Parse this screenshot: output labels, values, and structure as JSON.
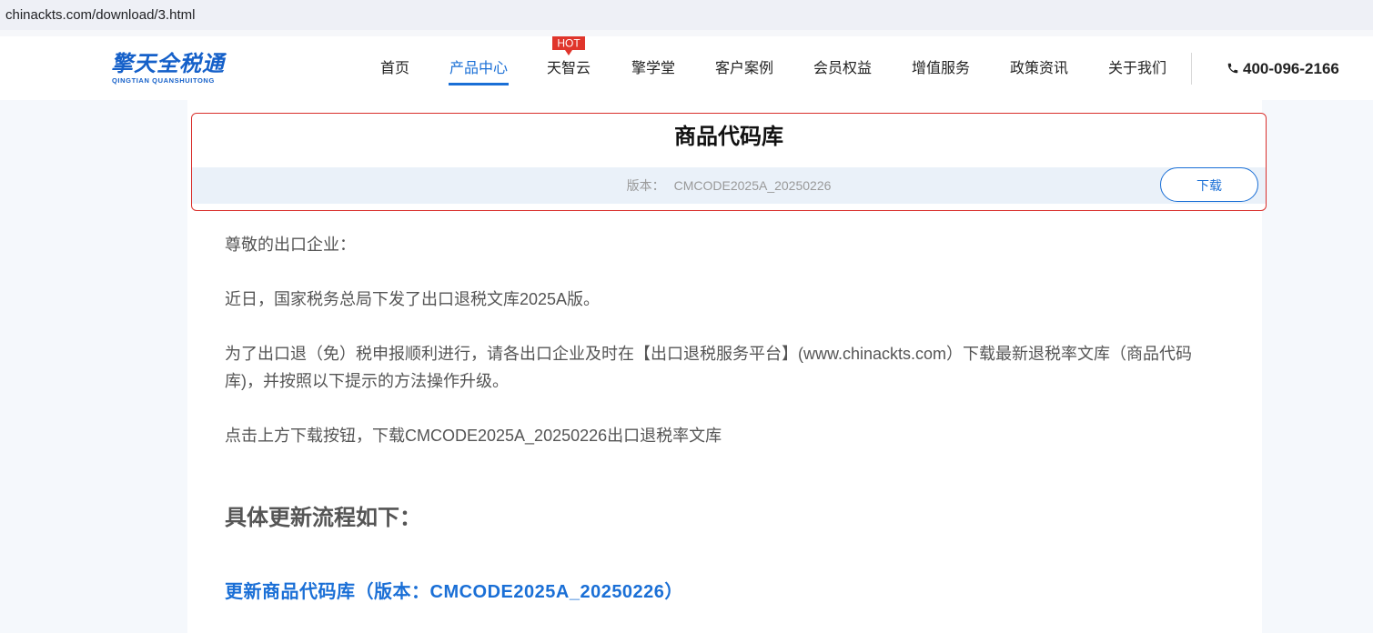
{
  "browser": {
    "url": "chinackts.com/download/3.html"
  },
  "header": {
    "logo_main": "擎天全税通",
    "logo_sub": "QINGTIAN QUANSHUITONG",
    "nav": [
      {
        "label": "首页"
      },
      {
        "label": "产品中心"
      },
      {
        "label": "天智云"
      },
      {
        "label": "擎学堂"
      },
      {
        "label": "客户案例"
      },
      {
        "label": "会员权益"
      },
      {
        "label": "增值服务"
      },
      {
        "label": "政策资讯"
      },
      {
        "label": "关于我们"
      }
    ],
    "active_nav": "产品中心",
    "hot_badge": "HOT",
    "phone": "400-096-2166"
  },
  "card": {
    "title": "商品代码库",
    "version_label": "版本：",
    "version_value": "CMCODE2025A_20250226",
    "download_label": "下载"
  },
  "article": {
    "greeting": "尊敬的出口企业：",
    "p1": "近日，国家税务总局下发了出口退税文库2025A版。",
    "p2": "为了出口退（免）税申报顺利进行，请各出口企业及时在【出口退税服务平台】(www.chinackts.com）下载最新退税率文库（商品代码库)，并按照以下提示的方法操作升级。",
    "p3": "点击上方下载按钮，下载CMCODE2025A_20250226出口退税率文库",
    "subheading": "具体更新流程如下：",
    "update_title": "更新商品代码库（版本：CMCODE2025A_20250226）"
  },
  "colors": {
    "brand_blue": "#1a6fd6",
    "card_border": "#d9302c",
    "hot_red": "#e0352b"
  }
}
